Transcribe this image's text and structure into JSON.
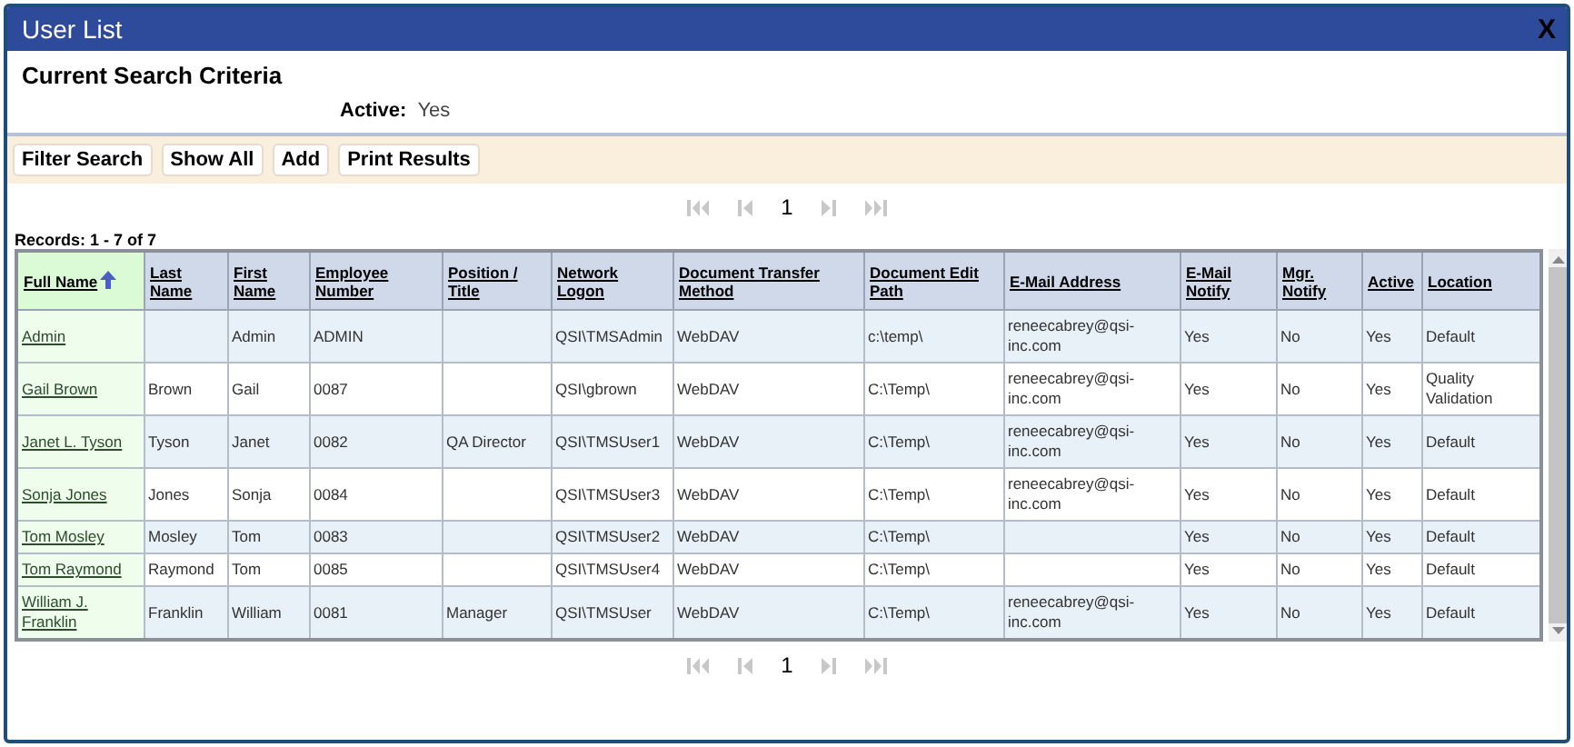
{
  "window": {
    "title": "User List",
    "close": "X"
  },
  "criteria": {
    "heading": "Current Search Criteria",
    "items": [
      {
        "label": "Active:",
        "value": "Yes"
      }
    ]
  },
  "toolbar": {
    "buttons": [
      "Filter Search",
      "Show All",
      "Add",
      "Print Results"
    ]
  },
  "pager_top": {
    "page": "1",
    "nav_disabled": true
  },
  "records": "Records: 1 - 7 of 7",
  "table": {
    "columns": [
      {
        "label": "Full Name",
        "sorted": true
      },
      {
        "label": "Last Name",
        "sorted": false
      },
      {
        "label": "First Name",
        "sorted": false
      },
      {
        "label": "Employee Number",
        "sorted": false
      },
      {
        "label": "Position / Title",
        "sorted": false
      },
      {
        "label": "Network Logon",
        "sorted": false
      },
      {
        "label": "Document Transfer Method",
        "sorted": false
      },
      {
        "label": "Document Edit Path",
        "sorted": false
      },
      {
        "label": "E-Mail Address",
        "sorted": false
      },
      {
        "label": "E-Mail Notify",
        "sorted": false
      },
      {
        "label": "Mgr. Notify",
        "sorted": false
      },
      {
        "label": "Active",
        "sorted": false
      },
      {
        "label": "Location",
        "sorted": false
      }
    ],
    "rows": [
      [
        "Admin",
        "",
        "Admin",
        "ADMIN",
        "",
        "QSI\\TMSAdmin",
        "WebDAV",
        "c:\\temp\\",
        "reneecabrey@qsi-inc.com",
        "Yes",
        "No",
        "Yes",
        "Default"
      ],
      [
        "Gail Brown",
        "Brown",
        "Gail",
        "0087",
        "",
        "QSI\\gbrown",
        "WebDAV",
        "C:\\Temp\\",
        "reneecabrey@qsi-inc.com",
        "Yes",
        "No",
        "Yes",
        "Quality Validation"
      ],
      [
        "Janet L. Tyson",
        "Tyson",
        "Janet",
        "0082",
        "QA Director",
        "QSI\\TMSUser1",
        "WebDAV",
        "C:\\Temp\\",
        "reneecabrey@qsi-inc.com",
        "Yes",
        "No",
        "Yes",
        "Default"
      ],
      [
        "Sonja Jones",
        "Jones",
        "Sonja",
        "0084",
        "",
        "QSI\\TMSUser3",
        "WebDAV",
        "C:\\Temp\\",
        "reneecabrey@qsi-inc.com",
        "Yes",
        "No",
        "Yes",
        "Default"
      ],
      [
        "Tom Mosley",
        "Mosley",
        "Tom",
        "0083",
        "",
        "QSI\\TMSUser2",
        "WebDAV",
        "C:\\Temp\\",
        "",
        "Yes",
        "No",
        "Yes",
        "Default"
      ],
      [
        "Tom Raymond",
        "Raymond",
        "Tom",
        "0085",
        "",
        "QSI\\TMSUser4",
        "WebDAV",
        "C:\\Temp\\",
        "",
        "Yes",
        "No",
        "Yes",
        "Default"
      ],
      [
        "William J. Franklin",
        "Franklin",
        "William",
        "0081",
        "Manager",
        "QSI\\TMSUser",
        "WebDAV",
        "C:\\Temp\\",
        "reneecabrey@qsi-inc.com",
        "Yes",
        "No",
        "Yes",
        "Default"
      ]
    ]
  },
  "pager_bottom": {
    "page": "1",
    "nav_disabled": true
  }
}
